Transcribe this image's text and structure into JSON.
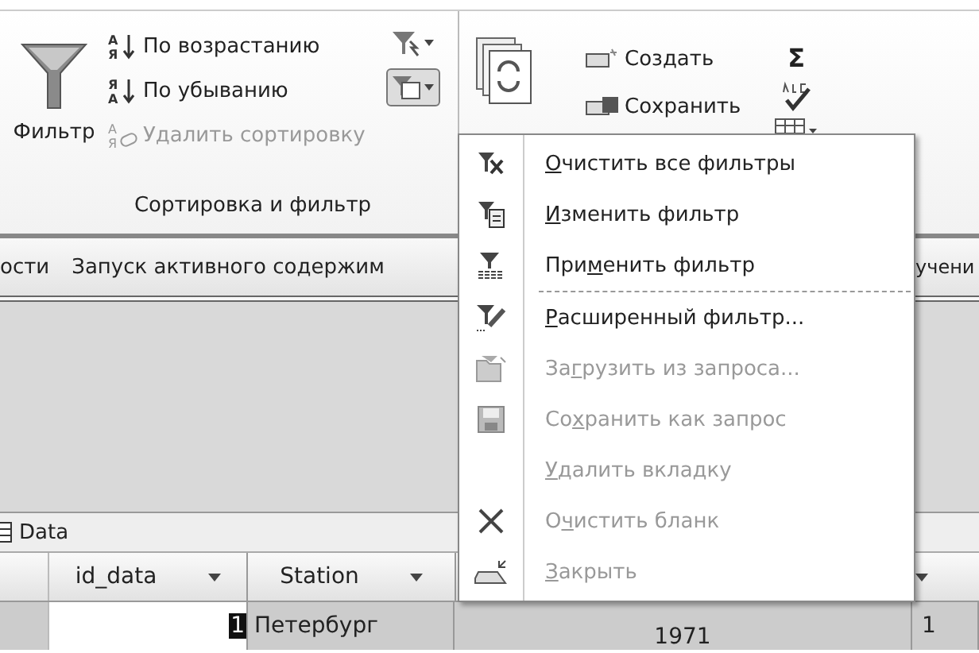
{
  "ribbon": {
    "sort_filter_group": {
      "title": "Сортировка и фильтр",
      "filter_button": "Фильтр",
      "sort_items": [
        {
          "label": "По возрастанию",
          "disabled": false,
          "icon_top": "А",
          "icon_bottom": "Я"
        },
        {
          "label": "По убыванию",
          "disabled": false,
          "icon_top": "Я",
          "icon_bottom": "А"
        },
        {
          "label": "Удалить сортировку",
          "disabled": true,
          "icon_top": "А",
          "icon_bottom": "Я"
        }
      ],
      "filter_options_button": {
        "expanded": true
      }
    },
    "records_group": {
      "items": [
        {
          "label": "Создать"
        },
        {
          "label": "Сохранить"
        }
      ],
      "sum_symbol": "Σ"
    }
  },
  "message_bar": {
    "texts": [
      "ости",
      "Запуск активного содержим",
      "учени"
    ]
  },
  "document_tab": {
    "label": "Data"
  },
  "table": {
    "columns": [
      {
        "label": "id_data"
      },
      {
        "label": "Station"
      }
    ],
    "row": [
      "1",
      "Петербург",
      "1971",
      "1"
    ]
  },
  "menu": {
    "items": [
      {
        "key": "О",
        "after": "чистить все фильтры",
        "disabled": false,
        "separator_after": false
      },
      {
        "key": "И",
        "after": "зменить фильтр",
        "disabled": false,
        "separator_after": false
      },
      {
        "before": "При",
        "key": "м",
        "after": "енить фильтр",
        "disabled": false,
        "separator_after": true
      },
      {
        "key": "Р",
        "after": "асширенный фильтр...",
        "disabled": false,
        "separator_after": false
      },
      {
        "before": "За",
        "key": "г",
        "after": "рузить из запроса...",
        "disabled": true,
        "separator_after": false
      },
      {
        "before": "Со",
        "key": "х",
        "after": "ранить как запрос",
        "disabled": true,
        "separator_after": false
      },
      {
        "key": "У",
        "after": "далить вкладку",
        "disabled": true,
        "separator_after": false
      },
      {
        "before": "О",
        "key": "ч",
        "after": "истить бланк",
        "disabled": true,
        "separator_after": false
      },
      {
        "key": "З",
        "after": "акрыть",
        "disabled": true,
        "separator_after": false
      }
    ]
  }
}
